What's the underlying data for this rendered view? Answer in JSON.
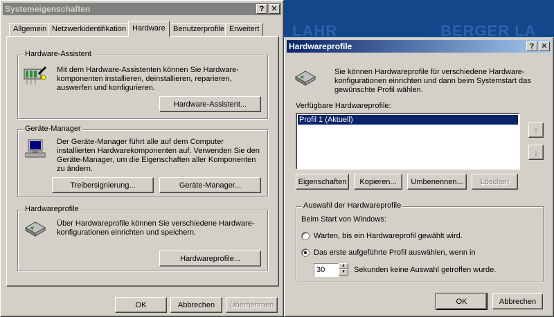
{
  "desktop": {
    "text_left": "LAHR",
    "text_right": "BERGER LA"
  },
  "sysprops": {
    "title": "Systemeigenschaften",
    "help_btn": "?",
    "close_btn": "✕",
    "tabs": [
      "Allgemein",
      "Netzwerkidentifikation",
      "Hardware",
      "Benutzerprofile",
      "Erweitert"
    ],
    "wizard": {
      "label": "Hardware-Assistent",
      "text": "Mit dem Hardware-Assistenten können Sie Hardware-komponenten installieren, deinstallieren, reparieren, auswerfen und konfigurieren.",
      "button": "Hardware-Assistent..."
    },
    "devmgr": {
      "label": "Geräte-Manager",
      "text": "Der Geräte-Manager führt alle auf dem Computer installierten Hardwarekomponenten auf. Verwenden Sie den Geräte-Manager, um die Eigenschaften aller Komponenten zu ändern.",
      "btn_sign": "Treibersignierung...",
      "btn_devmgr": "Geräte-Manager..."
    },
    "hwprofiles": {
      "label": "Hardwareprofile",
      "text": "Über Hardwareprofile können Sie verschiedene Hardware-konfigurationen einrichten und speichern.",
      "button": "Hardwareprofile..."
    },
    "footer": {
      "ok": "OK",
      "cancel": "Abbrechen",
      "apply": "Übernehmen"
    }
  },
  "hwdialog": {
    "title": "Hardwareprofile",
    "help_btn": "?",
    "close_btn": "✕",
    "intro": "Sie können Hardwareprofile für verschiedene Hardware-konfigurationen einrichten und dann beim Systemstart das gewünschte Profil wählen.",
    "list_label": "Verfügbare Hardwareprofile:",
    "profiles": [
      "Profil 1 (Aktuell)"
    ],
    "up_arrow": "↑",
    "down_arrow": "↓",
    "buttons": {
      "properties": "Eigenschaften",
      "copy": "Kopieren...",
      "rename": "Umbenennen...",
      "delete": "Löschen"
    },
    "selection": {
      "label": "Auswahl der Hardwareprofile",
      "startup_text": "Beim Start von Windows:",
      "radio_wait": "Warten, bis ein Hardwareprofil gewählt wird.",
      "radio_first": "Das erste aufgeführte Profil auswählen, wenn in",
      "seconds_value": "30",
      "seconds_text": "Sekunden keine Auswahl getroffen wurde."
    },
    "footer": {
      "ok": "OK",
      "cancel": "Abbrechen"
    }
  }
}
